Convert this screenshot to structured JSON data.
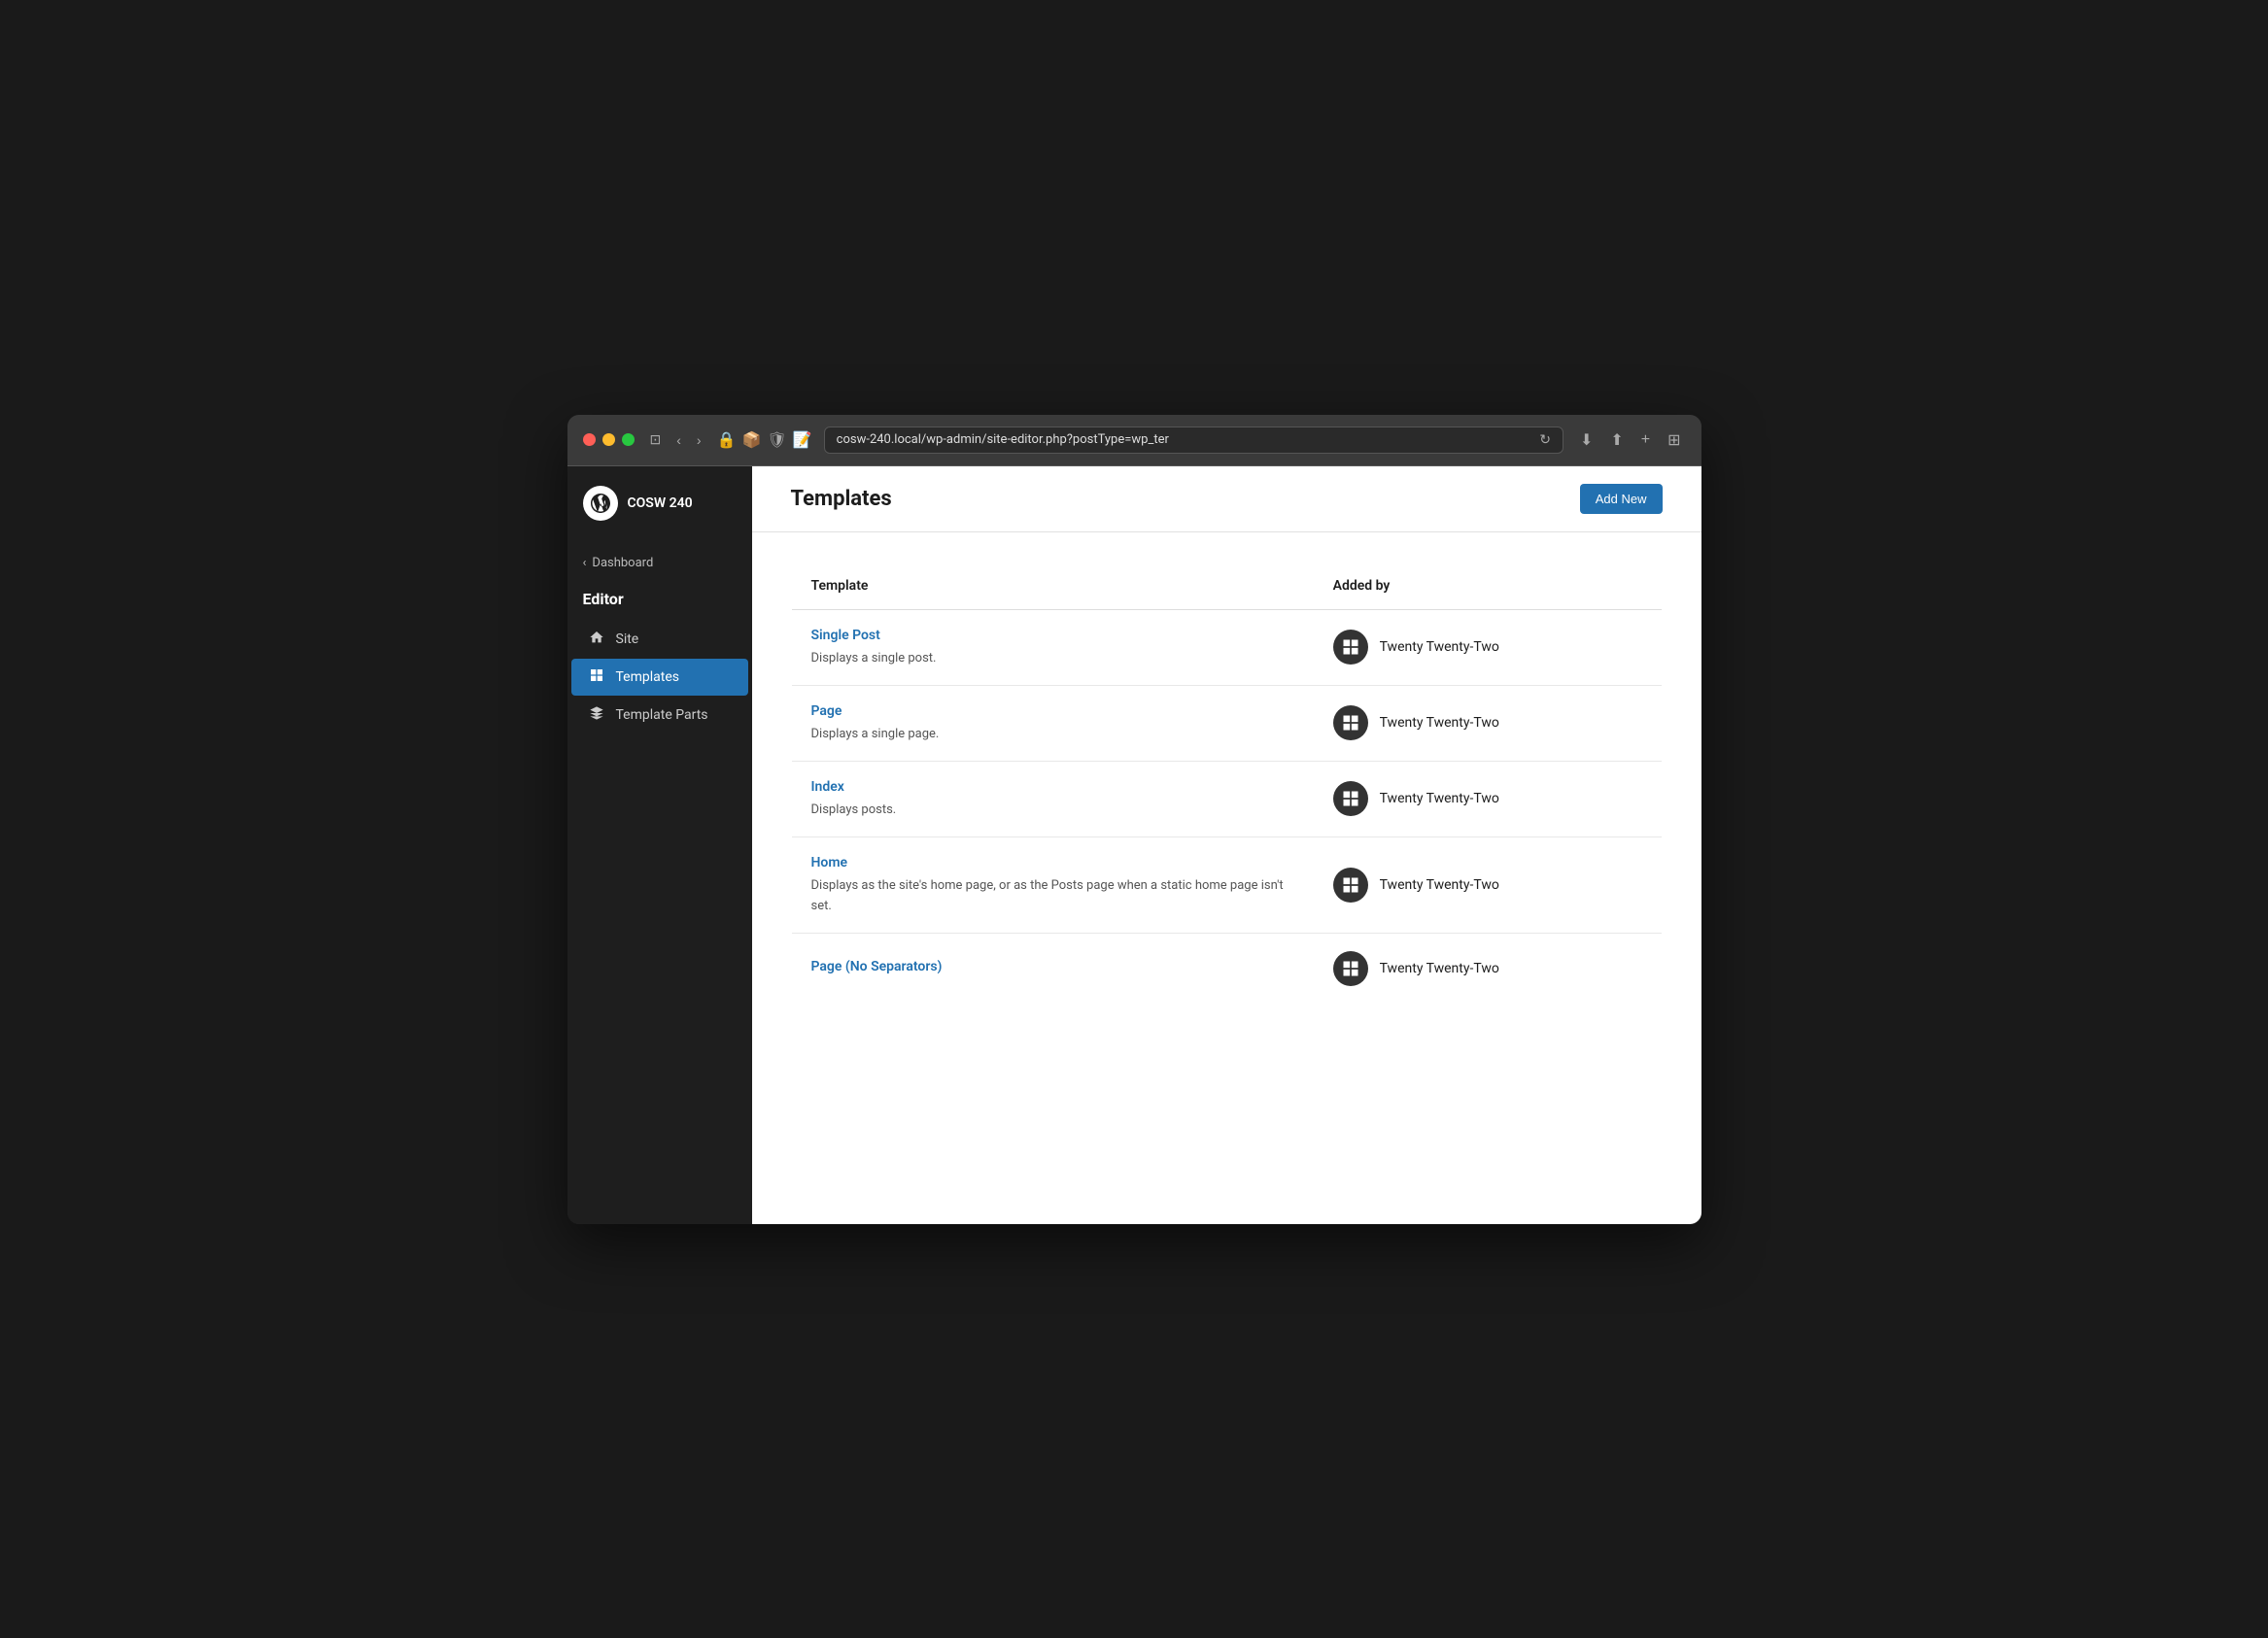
{
  "browser": {
    "url": "cosw-240.local/wp-admin/site-editor.php?postType=wp_ter",
    "back_label": "‹",
    "forward_label": "›"
  },
  "sidebar": {
    "logo_alt": "WordPress",
    "site_name": "COSW 240",
    "back_label": "Dashboard",
    "section_title": "Editor",
    "items": [
      {
        "id": "site",
        "label": "Site",
        "icon": "⌂"
      },
      {
        "id": "templates",
        "label": "Templates",
        "icon": "▦",
        "active": true
      },
      {
        "id": "template-parts",
        "label": "Template Parts",
        "icon": "◈"
      }
    ]
  },
  "main": {
    "title": "Templates",
    "add_new_label": "Add New"
  },
  "table": {
    "columns": [
      {
        "id": "template",
        "label": "Template"
      },
      {
        "id": "added-by",
        "label": "Added by"
      }
    ],
    "rows": [
      {
        "name": "Single Post",
        "description": "Displays a single post.",
        "added_by": "Twenty Twenty-Two"
      },
      {
        "name": "Page",
        "description": "Displays a single page.",
        "added_by": "Twenty Twenty-Two"
      },
      {
        "name": "Index",
        "description": "Displays posts.",
        "added_by": "Twenty Twenty-Two"
      },
      {
        "name": "Home",
        "description": "Displays as the site's home page, or as the Posts page when a static home page isn't set.",
        "added_by": "Twenty Twenty-Two"
      },
      {
        "name": "Page (No Separators)",
        "description": "",
        "added_by": "Twenty Twenty-Two"
      }
    ]
  }
}
